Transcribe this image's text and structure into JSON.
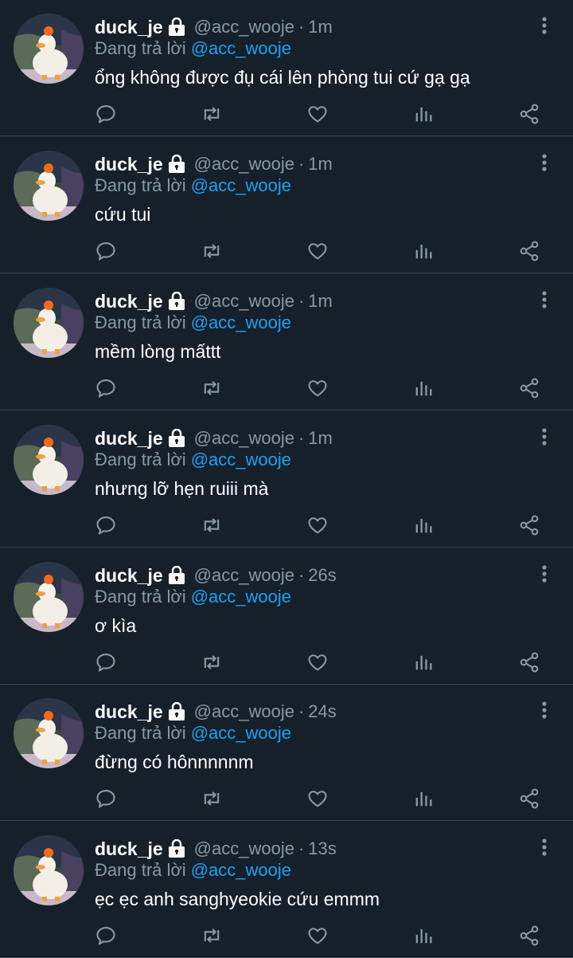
{
  "colors": {
    "background": "#15202b",
    "divider": "#38444d",
    "muted": "#8899a6",
    "link": "#1da1f2",
    "text": "#ffffff"
  },
  "tweets": [
    {
      "name": "duck_je",
      "handle": "@acc_wooje",
      "separator": "·",
      "time": "1m",
      "reply_prefix": "Đang trả lời",
      "reply_to": "@acc_wooje",
      "text": "ổng không được đụ cái lên phòng tui cứ gạ gạ",
      "icons": [
        "lock-icon",
        "more-icon",
        "reply-icon",
        "retweet-icon",
        "like-icon",
        "analytics-icon",
        "share-icon"
      ]
    },
    {
      "name": "duck_je",
      "handle": "@acc_wooje",
      "separator": "·",
      "time": "1m",
      "reply_prefix": "Đang trả lời",
      "reply_to": "@acc_wooje",
      "text": "cứu tui"
    },
    {
      "name": "duck_je",
      "handle": "@acc_wooje",
      "separator": "·",
      "time": "1m",
      "reply_prefix": "Đang trả lời",
      "reply_to": "@acc_wooje",
      "text": "mềm lòng mấttt"
    },
    {
      "name": "duck_je",
      "handle": "@acc_wooje",
      "separator": "·",
      "time": "1m",
      "reply_prefix": "Đang trả lời",
      "reply_to": "@acc_wooje",
      "text": "nhưng lỡ hẹn ruiii mà"
    },
    {
      "name": "duck_je",
      "handle": "@acc_wooje",
      "separator": "·",
      "time": "26s",
      "reply_prefix": "Đang trả lời",
      "reply_to": "@acc_wooje",
      "text": "ơ kìa"
    },
    {
      "name": "duck_je",
      "handle": "@acc_wooje",
      "separator": "·",
      "time": "24s",
      "reply_prefix": "Đang trả lời",
      "reply_to": "@acc_wooje",
      "text": "đừng có hônnnnnm"
    },
    {
      "name": "duck_je",
      "handle": "@acc_wooje",
      "separator": "·",
      "time": "13s",
      "reply_prefix": "Đang trả lời",
      "reply_to": "@acc_wooje",
      "text": "ẹc ẹc anh sanghyeokie cứu emmm"
    }
  ]
}
